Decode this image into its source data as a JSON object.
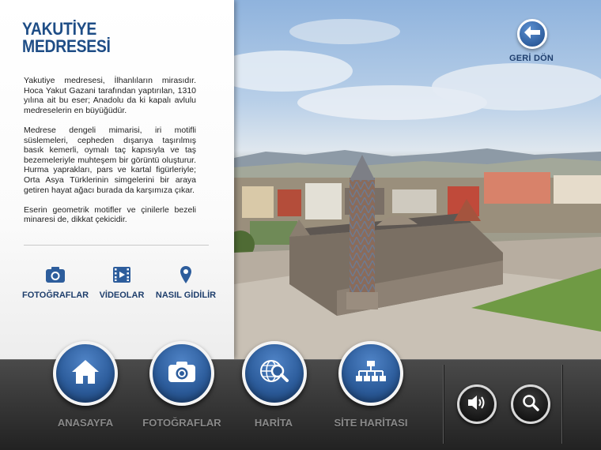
{
  "panel": {
    "title_line1": "YAKUTİYE",
    "title_line2": "MEDRESESİ",
    "paragraphs": [
      "Yakutiye medresesi, İlhanlıların mirasıdır. Hoca Yakut Gazani tarafından yaptırılan, 1310 yılına ait bu eser; Anadolu da ki kapalı avlulu medreselerin en büyüğüdür.",
      "Medrese dengeli mimarisi, iri motifli süslemeleri, cepheden dışarıya taşırılmış basık kemerli, oymalı taç kapısıyla ve taş bezemeleriyle muhteşem bir görüntü oluşturur. Hurma yaprakları, pars ve kartal figürleriyle; Orta Asya Türklerinin simgelerini bir araya getiren hayat ağacı burada da karşımıza çıkar.",
      "Eserin geometrik motifler ve çinilerle bezeli minaresi de, dikkat çekicidir."
    ],
    "links": [
      {
        "label": "FOTOĞRAFLAR",
        "icon": "camera-icon"
      },
      {
        "label": "VİDEOLAR",
        "icon": "film-icon"
      },
      {
        "label": "NASIL GİDİLİR",
        "icon": "map-pin-icon"
      }
    ]
  },
  "back": {
    "label": "GERİ DÖN",
    "icon": "arrow-left-icon"
  },
  "nav": [
    {
      "label": "ANASAYFA",
      "icon": "home-icon"
    },
    {
      "label": "FOTOĞRAFLAR",
      "icon": "camera-icon"
    },
    {
      "label": "HARİTA",
      "icon": "globe-search-icon"
    },
    {
      "label": "SİTE HARİTASI",
      "icon": "sitemap-icon"
    }
  ],
  "tools": [
    {
      "icon": "speaker-icon"
    },
    {
      "icon": "search-icon"
    }
  ],
  "colors": {
    "accent_blue": "#2d5d9c",
    "title_blue": "#1e4d86",
    "bar_dark": "#2a2a2a",
    "nav_label_gray": "#8a8a8a"
  }
}
